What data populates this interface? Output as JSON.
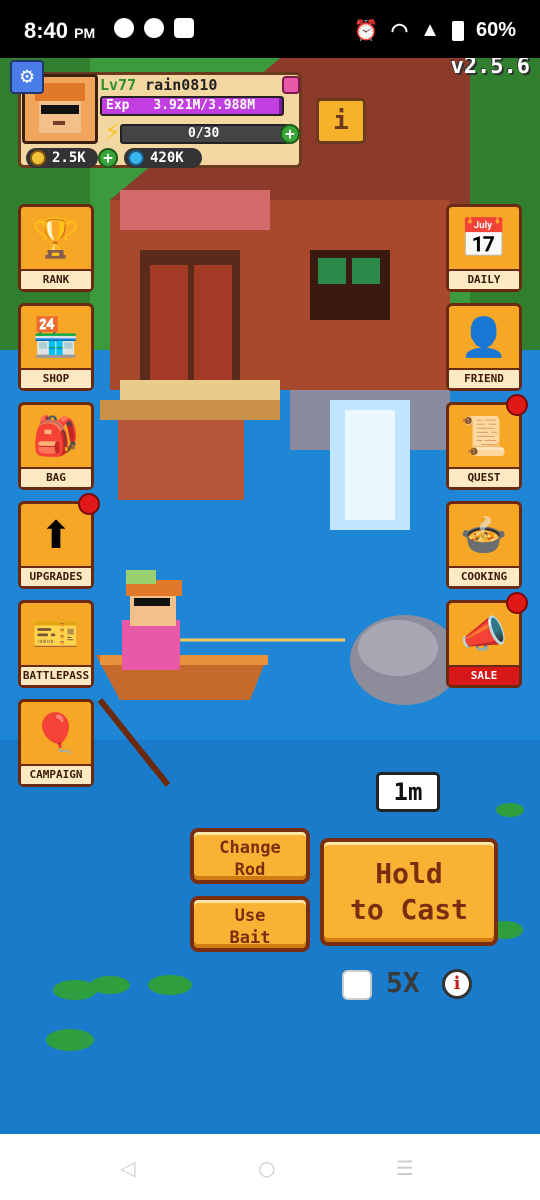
{
  "status_bar": {
    "time": "8:40",
    "ampm": "PM",
    "battery": "60%"
  },
  "version": "v2.5.6",
  "player": {
    "level_prefix": "Lv",
    "level": "77",
    "name": "rain0810",
    "exp_label": "Exp",
    "exp_text": "3.921M/3.988M",
    "exp_fraction": 0.983,
    "energy_text": "0/30",
    "coins": "2.5K",
    "gems": "420K"
  },
  "left_menu": [
    {
      "id": "rank",
      "label": "RANK",
      "icon": "trophy-icon",
      "glyph": "🏆",
      "badge": false
    },
    {
      "id": "shop",
      "label": "SHOP",
      "icon": "shop-icon",
      "glyph": "🏪",
      "badge": false
    },
    {
      "id": "bag",
      "label": "BAG",
      "icon": "backpack-icon",
      "glyph": "🎒",
      "badge": false
    },
    {
      "id": "upgrades",
      "label": "UPGRADES",
      "icon": "upgrade-arrow-icon",
      "glyph": "⬆",
      "badge": true
    },
    {
      "id": "battlepass",
      "label": "BATTLEPASS",
      "icon": "ticket-icon",
      "glyph": "🎫",
      "badge": false
    },
    {
      "id": "campaign",
      "label": "CAMPAIGN",
      "icon": "balloon-icon",
      "glyph": "🎈",
      "badge": false
    }
  ],
  "right_menu": [
    {
      "id": "daily",
      "label": "DAILY",
      "icon": "calendar-icon",
      "glyph": "📅",
      "badge": false
    },
    {
      "id": "friend",
      "label": "FRIEND",
      "icon": "add-friend-icon",
      "glyph": "👤",
      "badge": false
    },
    {
      "id": "quest",
      "label": "QUEST",
      "icon": "scroll-icon",
      "glyph": "📜",
      "badge": true
    },
    {
      "id": "cooking",
      "label": "COOKING",
      "icon": "cooking-pot-icon",
      "glyph": "🍲",
      "badge": false
    },
    {
      "id": "sale",
      "label": "SALE",
      "icon": "megaphone-icon",
      "glyph": "📣",
      "badge": true
    }
  ],
  "cast_distance": "1m",
  "actions": {
    "change_rod": "Change\nRod",
    "use_bait": "Use\nBait",
    "hold_to_cast": "Hold\nto Cast"
  },
  "multiplier": {
    "label": "5X",
    "checked": false,
    "info": "i"
  },
  "info_button": "i",
  "gear_glyph": "⚙",
  "nav": {
    "back": "◁",
    "home": "○",
    "recents": "☰"
  }
}
